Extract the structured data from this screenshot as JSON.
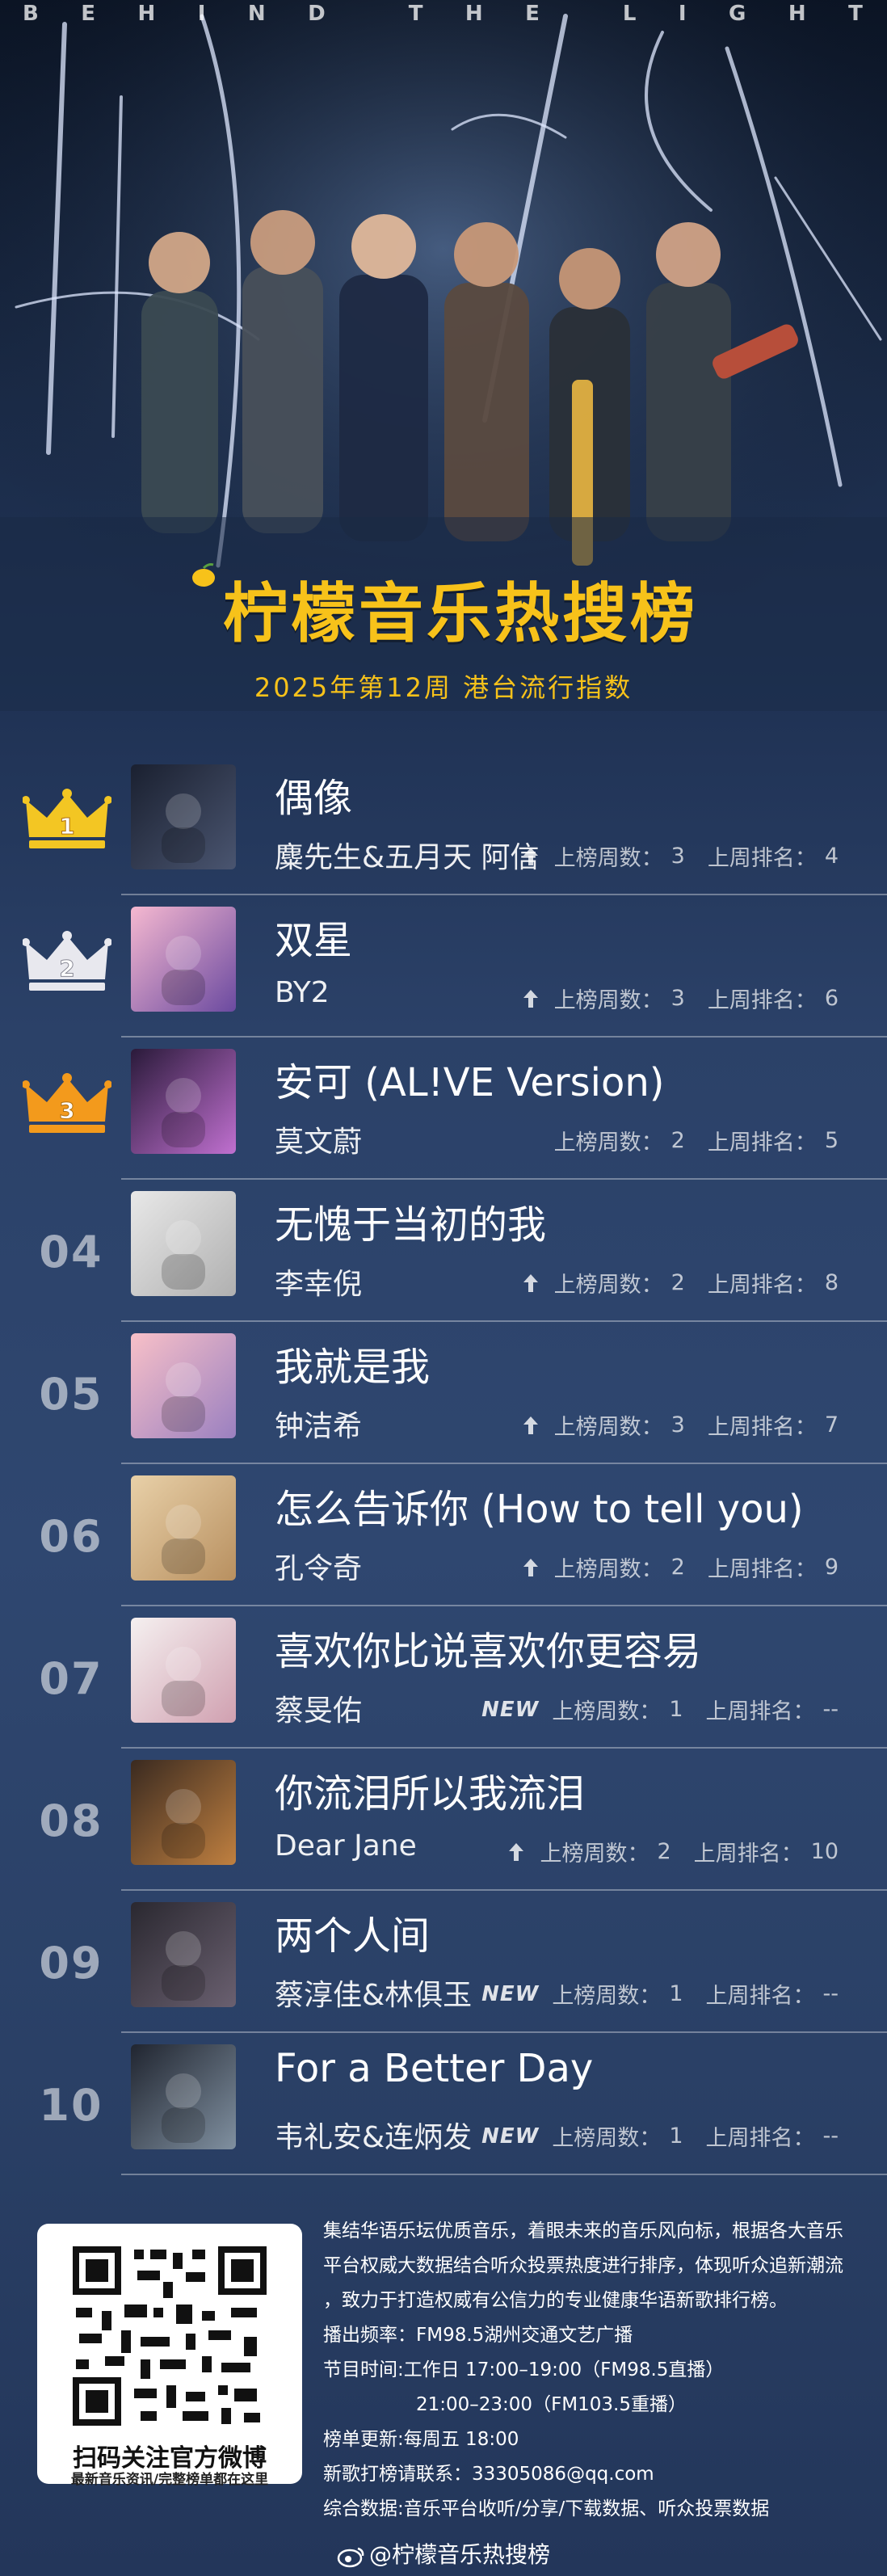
{
  "header": {
    "tagline_letters": [
      "B",
      "E",
      "H",
      "I",
      "N",
      "D",
      "",
      "T",
      "H",
      "E",
      "",
      "L",
      "I",
      "G",
      "H",
      "T"
    ],
    "title": "柠檬音乐热搜榜",
    "subtitle": "2025年第12周 港台流行指数"
  },
  "stats_labels": {
    "weeks": "上榜周数：",
    "last": "上周排名："
  },
  "ranking": [
    {
      "rank": "1",
      "song": "偶像",
      "artist": "麋先生&五月天 阿信",
      "trend": "up",
      "weeks": "3",
      "last": "4",
      "cover_colors": [
        "#1a2030",
        "#4a5570"
      ]
    },
    {
      "rank": "2",
      "song": "双星",
      "artist": "BY2",
      "trend": "up",
      "weeks": "3",
      "last": "6",
      "cover_colors": [
        "#f5b8d0",
        "#6b4aa0"
      ]
    },
    {
      "rank": "3",
      "song": "安可 (AL!VE Version)",
      "artist": "莫文蔚",
      "trend": "",
      "weeks": "2",
      "last": "5",
      "cover_colors": [
        "#2a1a3a",
        "#c070d0"
      ]
    },
    {
      "rank": "04",
      "song": "无愧于当初的我",
      "artist": "李幸倪",
      "trend": "up",
      "weeks": "2",
      "last": "8",
      "cover_colors": [
        "#e8e8e8",
        "#b0b0b0"
      ]
    },
    {
      "rank": "05",
      "song": "我就是我",
      "artist": "钟洁希",
      "trend": "up",
      "weeks": "3",
      "last": "7",
      "cover_colors": [
        "#f8c0c8",
        "#9a80c0"
      ]
    },
    {
      "rank": "06",
      "song": "怎么告诉你 (How to tell you)",
      "artist": "孔令奇",
      "trend": "up",
      "weeks": "2",
      "last": "9",
      "cover_colors": [
        "#e8d0a8",
        "#b89060"
      ]
    },
    {
      "rank": "07",
      "song": "喜欢你比说喜欢你更容易",
      "artist": "蔡旻佑",
      "trend": "new",
      "weeks": "1",
      "last": "--",
      "cover_colors": [
        "#f5f0f0",
        "#d0a0b0"
      ]
    },
    {
      "rank": "08",
      "song": "你流泪所以我流泪",
      "artist": "Dear Jane",
      "trend": "up",
      "weeks": "2",
      "last": "10",
      "cover_colors": [
        "#3a2a20",
        "#c08040"
      ]
    },
    {
      "rank": "09",
      "song": "两个人间",
      "artist": "蔡淳佳&林俱玉",
      "trend": "new",
      "weeks": "1",
      "last": "--",
      "cover_colors": [
        "#2a2830",
        "#6a6070"
      ]
    },
    {
      "rank": "10",
      "song": "For a Better Day",
      "artist": "韦礼安&连炳发",
      "trend": "new",
      "weeks": "1",
      "last": "--",
      "cover_colors": [
        "#202530",
        "#8090a0"
      ]
    }
  ],
  "new_label": "NEW",
  "qr": {
    "label": "扫码关注官方微博",
    "sub": "最新音乐资讯/完整榜单都在这里"
  },
  "info_lines": [
    "集结华语乐坛优质音乐，着眼未来的音乐风向标，根据各大音乐",
    "平台权威大数据结合听众投票热度进行排序，体现听众追新潮流",
    "，致力于打造权威有公信力的专业健康华语新歌排行榜。",
    "播出频率：FM98.5湖州交通文艺广播",
    "节目时间:工作日 17:00–19:00（FM98.5直播）",
    "　　　　　21:00–23:00（FM103.5重播）",
    "榜单更新:每周五 18:00",
    "新歌打榜请联系：33305086@qq.com",
    "综合数据:音乐平台收听/分享/下载数据、听众投票数据"
  ],
  "weibo_handle": "@柠檬音乐热搜榜",
  "colors": {
    "accent": "#f7c21a",
    "gold": "#f3c623",
    "silver": "#e8e8ee",
    "bronze": "#f39a1c"
  }
}
